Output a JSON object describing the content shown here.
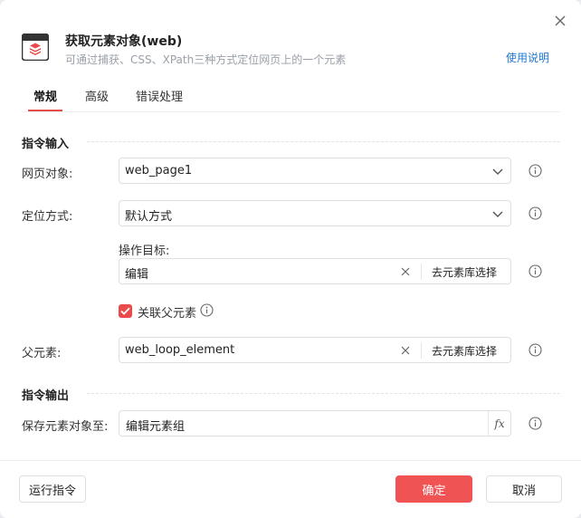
{
  "header": {
    "title": "获取元素对象(web)",
    "subtitle": "可通过捕获、CSS、XPath三种方式定位网页上的一个元素",
    "help_link": "使用说明",
    "icon_color": "#e94b4b"
  },
  "tabs": [
    {
      "label": "常规",
      "active": true
    },
    {
      "label": "高级",
      "active": false
    },
    {
      "label": "错误处理",
      "active": false
    }
  ],
  "input_section": {
    "title": "指令输入",
    "web_page": {
      "label": "网页对象:",
      "value": "web_page1"
    },
    "locate_mode": {
      "label": "定位方式:",
      "value": "默认方式"
    },
    "target": {
      "label": "操作目标:",
      "value": "编辑",
      "lib_button": "去元素库选择"
    },
    "link_parent": {
      "label": "关联父元素",
      "checked": true
    },
    "parent": {
      "label": "父元素:",
      "value": "web_loop_element",
      "lib_button": "去元素库选择"
    }
  },
  "output_section": {
    "title": "指令输出",
    "save_to": {
      "label": "保存元素对象至:",
      "value": "编辑元素组",
      "fx": "fx"
    }
  },
  "footer": {
    "run_label": "运行指令",
    "confirm_label": "确定",
    "cancel_label": "取消"
  },
  "colors": {
    "accent": "#e94b4b",
    "link": "#1f78d1"
  }
}
